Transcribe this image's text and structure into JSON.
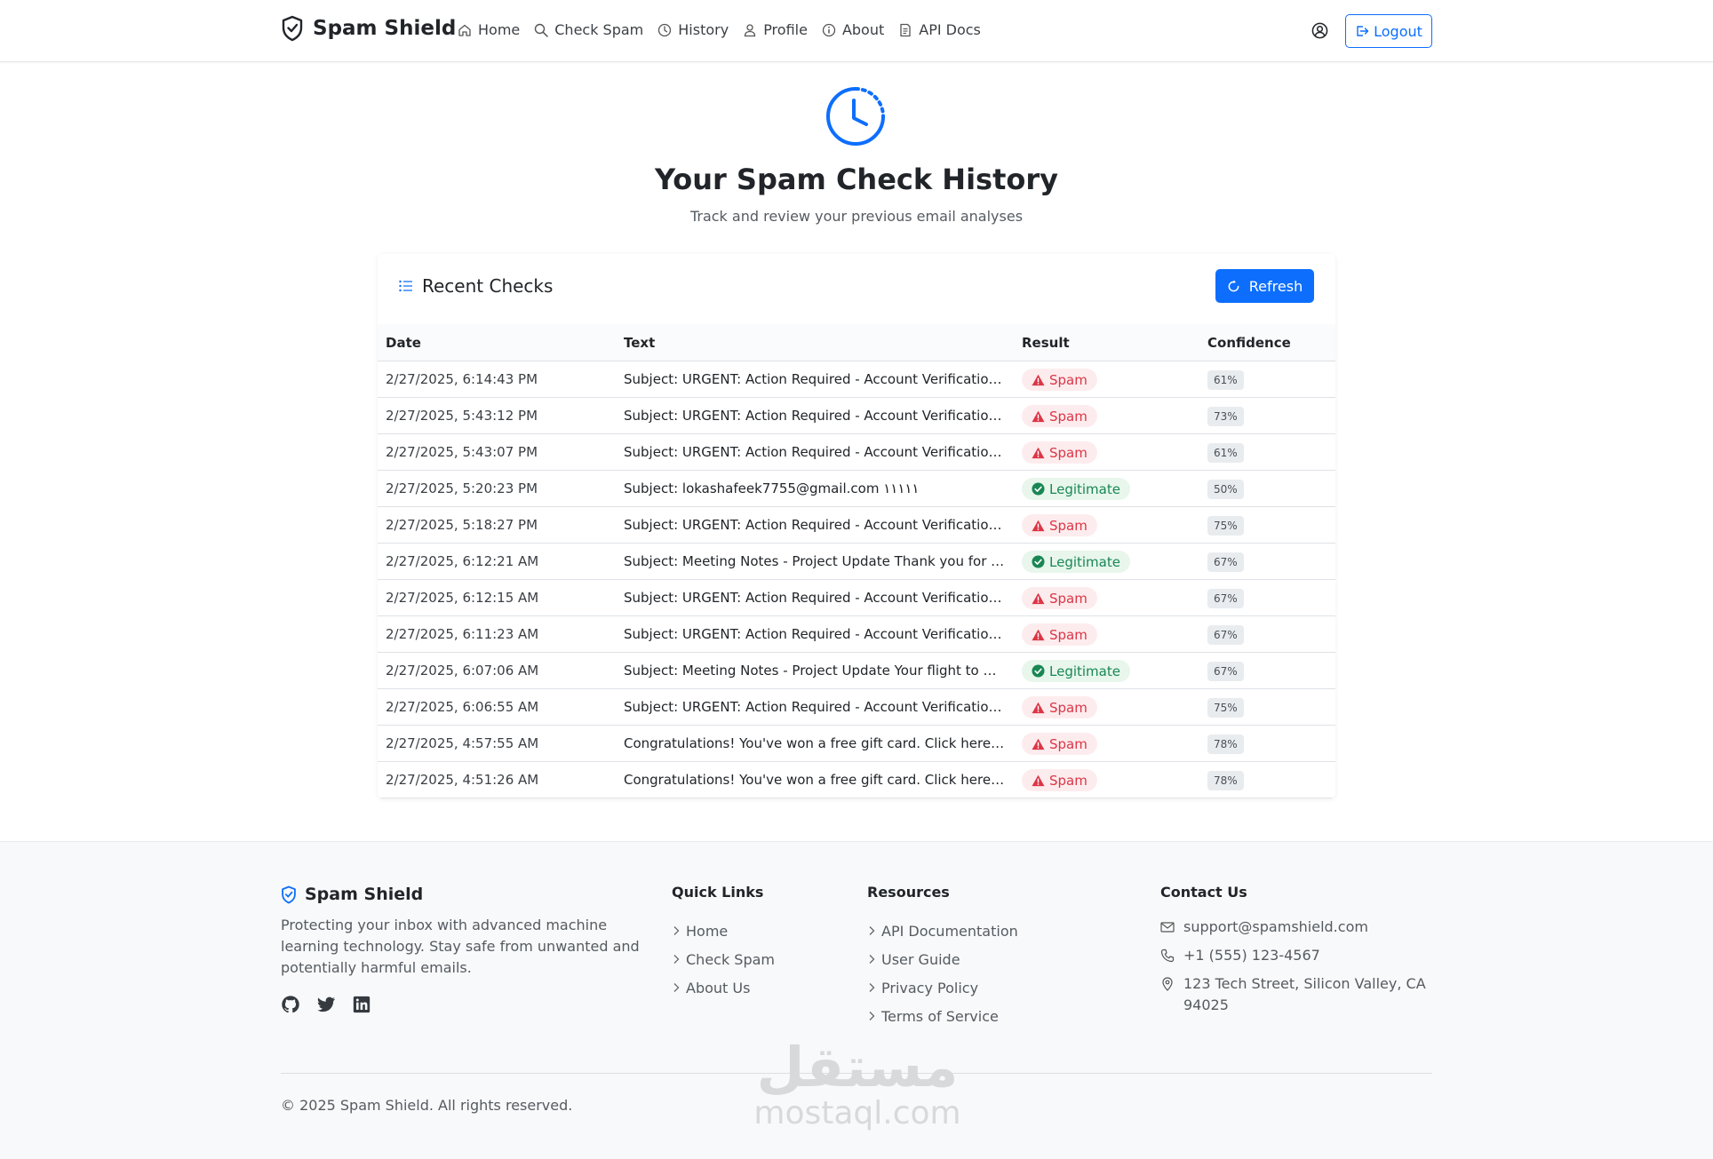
{
  "navbar": {
    "brand": "Spam Shield",
    "links": [
      {
        "label": "Home",
        "icon": "home-icon"
      },
      {
        "label": "Check Spam",
        "icon": "search-icon"
      },
      {
        "label": "History",
        "icon": "clock-icon"
      },
      {
        "label": "Profile",
        "icon": "user-icon"
      },
      {
        "label": "About",
        "icon": "info-icon"
      },
      {
        "label": "API Docs",
        "icon": "document-icon"
      }
    ],
    "logout_label": "Logout"
  },
  "hero": {
    "title": "Your Spam Check History",
    "subtitle": "Track and review your previous email analyses"
  },
  "card": {
    "title": "Recent Checks",
    "refresh_label": "Refresh",
    "columns": [
      "Date",
      "Text",
      "Result",
      "Confidence"
    ],
    "rows": [
      {
        "date": "2/27/2025, 6:14:43 PM",
        "text": "Subject: URGENT: Action Required - Account Verification I...",
        "result": "Spam",
        "confidence": "61%"
      },
      {
        "date": "2/27/2025, 5:43:12 PM",
        "text": "Subject: URGENT: Action Required - Account Verification ...",
        "result": "Spam",
        "confidence": "73%"
      },
      {
        "date": "2/27/2025, 5:43:07 PM",
        "text": "Subject: URGENT: Action Required - Account Verification I...",
        "result": "Spam",
        "confidence": "61%"
      },
      {
        "date": "2/27/2025, 5:20:23 PM",
        "text": "Subject: lokashafeek7755@gmail.com ١١١١١",
        "result": "Legitimate",
        "confidence": "50%"
      },
      {
        "date": "2/27/2025, 5:18:27 PM",
        "text": "Subject: URGENT: Action Required - Account Verification ...",
        "result": "Spam",
        "confidence": "75%"
      },
      {
        "date": "2/27/2025, 6:12:21 AM",
        "text": "Subject: Meeting Notes - Project Update Thank you for y...",
        "result": "Legitimate",
        "confidence": "67%"
      },
      {
        "date": "2/27/2025, 6:12:15 AM",
        "text": "Subject: URGENT: Action Required - Account Verification ...",
        "result": "Spam",
        "confidence": "67%"
      },
      {
        "date": "2/27/2025, 6:11:23 AM",
        "text": "Subject: URGENT: Action Required - Account Verification ...",
        "result": "Spam",
        "confidence": "67%"
      },
      {
        "date": "2/27/2025, 6:07:06 AM",
        "text": "Subject: Meeting Notes - Project Update Your flight to N...",
        "result": "Legitimate",
        "confidence": "67%"
      },
      {
        "date": "2/27/2025, 6:06:55 AM",
        "text": "Subject: URGENT: Action Required - Account Verification ...",
        "result": "Spam",
        "confidence": "75%"
      },
      {
        "date": "2/27/2025, 4:57:55 AM",
        "text": "Congratulations! You've won a free gift card. Click here t...",
        "result": "Spam",
        "confidence": "78%"
      },
      {
        "date": "2/27/2025, 4:51:26 AM",
        "text": "Congratulations! You've won a free gift card. Click here t...",
        "result": "Spam",
        "confidence": "78%"
      }
    ]
  },
  "footer": {
    "brand": "Spam Shield",
    "description": "Protecting your inbox with advanced machine learning technology. Stay safe from unwanted and potentially harmful emails.",
    "social_icons": [
      "github-icon",
      "twitter-icon",
      "linkedin-icon"
    ],
    "quick_links": {
      "title": "Quick Links",
      "items": [
        "Home",
        "Check Spam",
        "About Us"
      ]
    },
    "resources": {
      "title": "Resources",
      "items": [
        "API Documentation",
        "User Guide",
        "Privacy Policy",
        "Terms of Service"
      ]
    },
    "contact": {
      "title": "Contact Us",
      "email": "support@spamshield.com",
      "phone": "+1 (555) 123-4567",
      "address": "123 Tech Street, Silicon Valley, CA 94025"
    },
    "copyright": "© 2025 Spam Shield. All rights reserved."
  },
  "watermark": {
    "arabic": "مستقل",
    "latin": "mostaql.com"
  },
  "colors": {
    "primary": "#0d6efd",
    "spam": "#dc3545",
    "legit": "#198754"
  }
}
